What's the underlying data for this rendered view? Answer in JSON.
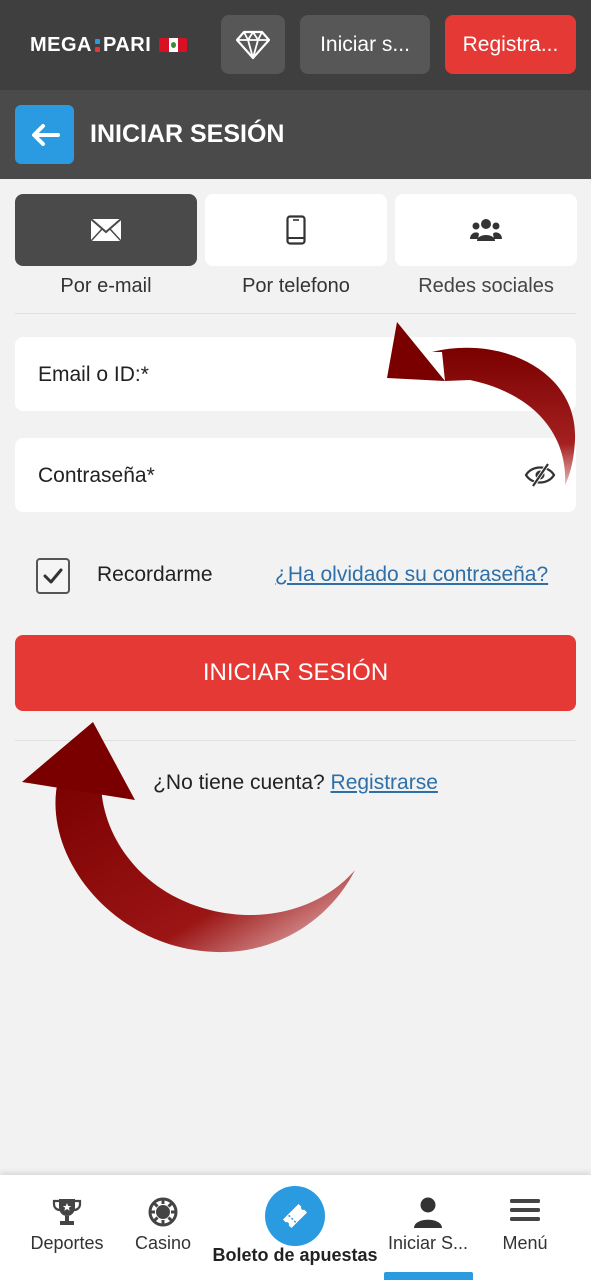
{
  "header": {
    "logo_left": "MEGA",
    "logo_right": "PARI",
    "login_label": "Iniciar s...",
    "register_label": "Registra...",
    "diamond_icon": "diamond-icon"
  },
  "subheader": {
    "title": "INICIAR SESIÓN",
    "back_icon": "arrow-left-icon"
  },
  "tabs": [
    {
      "label": "Por e-mail",
      "icon": "envelope-icon",
      "active": true
    },
    {
      "label": "Por telefono",
      "icon": "phone-icon",
      "active": false
    },
    {
      "label": "Redes sociales",
      "icon": "users-icon",
      "active": false
    }
  ],
  "form": {
    "email_placeholder": "Email o ID:*",
    "password_placeholder": "Contraseña*",
    "remember_label": "Recordarme",
    "remember_checked": true,
    "forgot_link": "¿Ha olvidado su contraseña?",
    "submit_label": "INICIAR SESIÓN",
    "no_account_text": "¿No tiene cuenta?",
    "register_link": "Registrarse"
  },
  "bottom_nav": [
    {
      "label": "Deportes",
      "icon": "trophy-icon"
    },
    {
      "label": "Casino",
      "icon": "casino-chip-icon"
    },
    {
      "label": "Boleto de apuestas",
      "icon": "ticket-icon"
    },
    {
      "label": "Iniciar S...",
      "icon": "user-icon",
      "active": true
    },
    {
      "label": "Menú",
      "icon": "hamburger-icon"
    }
  ],
  "colors": {
    "accent_red": "#e53935",
    "accent_blue": "#2a9be0",
    "dark_bar": "#3f3f3f",
    "arrow": "#8b0000"
  }
}
